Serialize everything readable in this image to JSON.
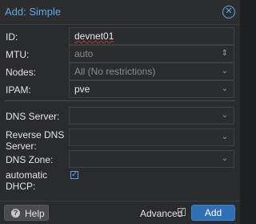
{
  "dialog": {
    "title": "Add: Simple",
    "close_icon": "close-circle-icon"
  },
  "fields": {
    "id": {
      "label": "ID:",
      "value": "devnet01"
    },
    "mtu": {
      "label": "MTU:",
      "placeholder": "auto"
    },
    "nodes": {
      "label": "Nodes:",
      "placeholder": "All (No restrictions)"
    },
    "ipam": {
      "label": "IPAM:",
      "value": "pve"
    },
    "dns_server": {
      "label": "DNS Server:",
      "value": ""
    },
    "reverse_dns": {
      "label_line1": "Reverse DNS",
      "label_line2": "Server:",
      "value": ""
    },
    "dns_zone": {
      "label": "DNS Zone:",
      "value": ""
    },
    "automatic_dhcp": {
      "label_line1": "automatic",
      "label_line2": "DHCP:",
      "checked": true
    }
  },
  "footer": {
    "help_label": "Help",
    "advanced_label": "Advanced",
    "advanced_checked": true,
    "add_label": "Add"
  },
  "colors": {
    "accent": "#62a6e8",
    "primary_button": "#2f6fb5",
    "background": "#2a2b2d"
  }
}
